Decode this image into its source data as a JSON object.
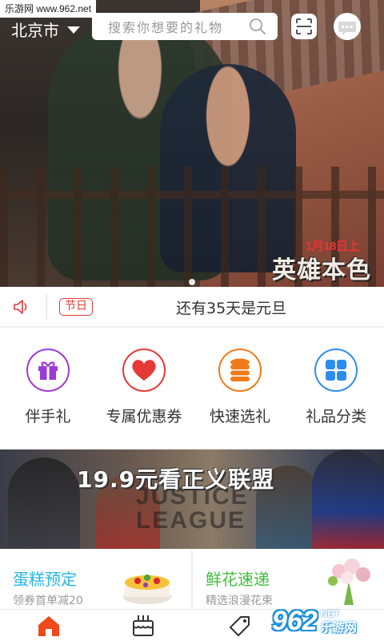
{
  "watermark": {
    "text": "乐游网 www.962.net"
  },
  "topbar": {
    "city": "北京市",
    "search_placeholder": "搜索你想要的礼物"
  },
  "hero": {
    "poster_date": "1月18日上",
    "poster_title": "英雄本色",
    "slide_count": 1
  },
  "notice": {
    "tag": "节日",
    "message": "还有35天是元旦"
  },
  "entries": [
    {
      "label": "伴手礼",
      "icon": "gift-icon",
      "color": "#9b3bd6"
    },
    {
      "label": "专属优惠券",
      "icon": "heart-icon",
      "color": "#e53935"
    },
    {
      "label": "快速选礼",
      "icon": "coins-icon",
      "color": "#f07a1a"
    },
    {
      "label": "礼品分类",
      "icon": "grid-icon",
      "color": "#2d8cf0"
    }
  ],
  "promo": {
    "title": "19.9元看正义联盟",
    "bg_text_line1": "JUSTICE",
    "bg_text_line2": "LEAGUE"
  },
  "cards": [
    {
      "title": "蛋糕预定",
      "subtitle": "领券首单减20",
      "color": "#26b6e8"
    },
    {
      "title": "鲜花速递",
      "subtitle": "精选浪漫花束",
      "color": "#3fbf3f"
    }
  ],
  "bottomnav": {
    "items": [
      "home-icon",
      "cake-icon",
      "tag-icon",
      "cart-icon"
    ],
    "active_color": "#f04a1a"
  },
  "logo": {
    "number": "962",
    "line1": "NET",
    "line2": "乐游网"
  }
}
